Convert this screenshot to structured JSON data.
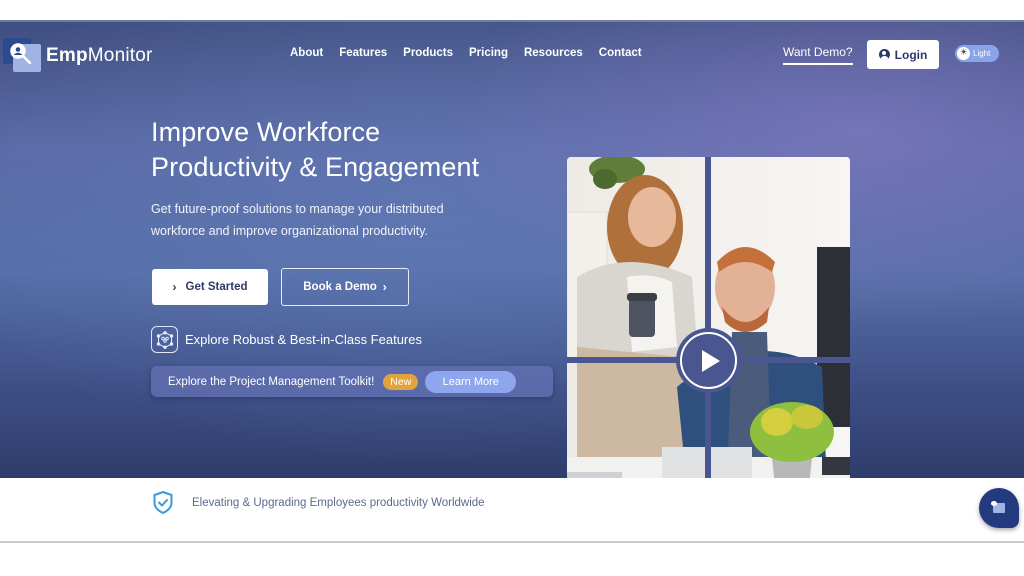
{
  "header": {
    "logo": {
      "bold": "Emp",
      "light": "Monitor"
    },
    "nav": [
      "About",
      "Features",
      "Products",
      "Pricing",
      "Resources",
      "Contact"
    ],
    "want_demo": "Want Demo?",
    "login": "Login",
    "theme_toggle": "Light"
  },
  "hero": {
    "title_line1": "Improve Workforce",
    "title_line2": "Productivity & Engagement",
    "subtitle_line1": "Get future-proof solutions to manage your distributed",
    "subtitle_line2": "workforce and improve organizational productivity.",
    "get_started": "Get Started",
    "book_demo": "Book a Demo",
    "explore_features": "Explore Robust & Best-in-Class Features",
    "toolkit": {
      "text": "Explore the Project Management Toolkit!",
      "badge": "New",
      "button": "Learn More"
    }
  },
  "bottom": {
    "tagline": "Elevating & Upgrading Employees productivity Worldwide"
  },
  "colors": {
    "brand_dark": "#2b3a6a",
    "badge_new": "#e0a43f",
    "learn_more": "#8ea6ee",
    "shield": "#3a9ad9",
    "chat": "#233a7e"
  }
}
